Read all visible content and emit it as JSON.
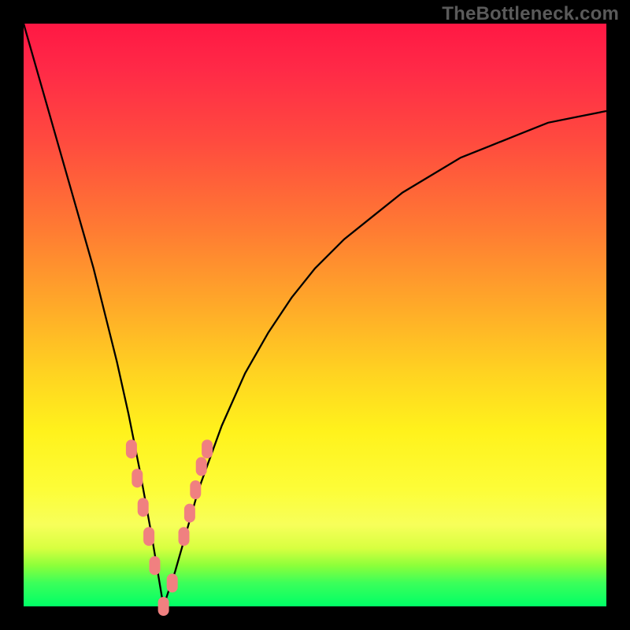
{
  "watermark": "TheBottleneck.com",
  "colors": {
    "frame": "#000000",
    "curve_stroke": "#000000",
    "marker_fill": "#f08080",
    "gradient_top": "#ff1844",
    "gradient_bottom": "#00ff66"
  },
  "chart_data": {
    "type": "line",
    "title": "",
    "xlabel": "",
    "ylabel": "",
    "xlim": [
      0,
      100
    ],
    "ylim": [
      0,
      100
    ],
    "note": "No axis ticks or numeric labels present. Data estimated from curve shape. y ≈ bottleneck percentage; minimum (optimal) near x ≈ 24.",
    "series": [
      {
        "name": "bottleneck-curve",
        "x": [
          0,
          2,
          4,
          6,
          8,
          10,
          12,
          14,
          16,
          18,
          20,
          22,
          24,
          26,
          28,
          30,
          34,
          38,
          42,
          46,
          50,
          55,
          60,
          65,
          70,
          75,
          80,
          85,
          90,
          95,
          100
        ],
        "y": [
          100,
          93,
          86,
          79,
          72,
          65,
          58,
          50,
          42,
          33,
          23,
          12,
          0,
          6,
          13,
          20,
          31,
          40,
          47,
          53,
          58,
          63,
          67,
          71,
          74,
          77,
          79,
          81,
          83,
          84,
          85
        ]
      }
    ],
    "markers": {
      "name": "highlighted-points",
      "x": [
        18.5,
        19.5,
        20.5,
        21.5,
        22.5,
        24,
        25.5,
        27.5,
        28.5,
        29.5,
        30.5,
        31.5
      ],
      "y": [
        27,
        22,
        17,
        12,
        7,
        0,
        4,
        12,
        16,
        20,
        24,
        27
      ]
    }
  }
}
